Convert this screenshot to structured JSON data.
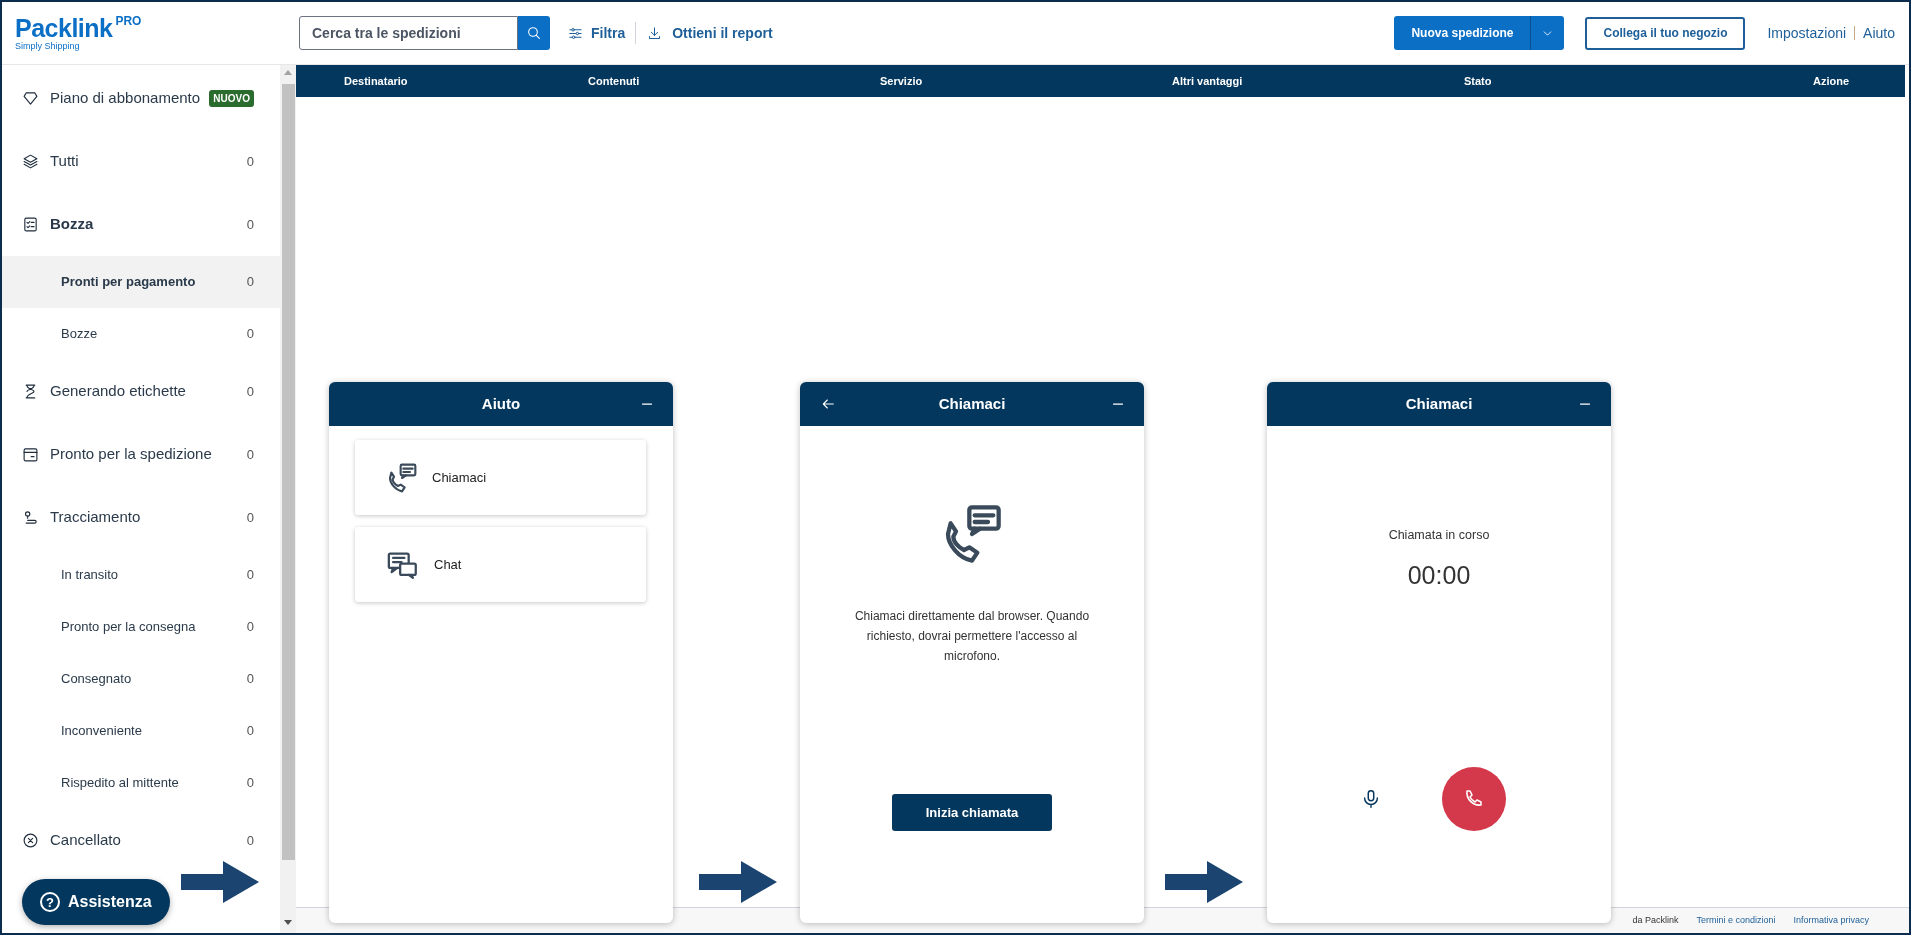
{
  "header": {
    "logo": "Packlink",
    "logo_badge": "PRO",
    "logo_tagline": "Simply Shipping",
    "search": {
      "placeholder": "Cerca tra le spedizioni"
    },
    "filter": "Filtra",
    "report": "Ottieni il report",
    "new_shipment": "Nuova spedizione",
    "connect_store": "Collega il tuo negozio",
    "links": [
      "Impostazioni",
      "Aiuto"
    ]
  },
  "sidebar": {
    "items": [
      {
        "label": "Piano di abbonamento",
        "kind": "plan",
        "badge": "NUOVO",
        "selected": false
      },
      {
        "label": "Tutti",
        "kind": "all",
        "count": "0",
        "selected": false
      },
      {
        "label": "Bozza",
        "kind": "draft",
        "count": "0",
        "selected": false,
        "children": [
          {
            "label": "Pronti per pagamento",
            "count": "0",
            "selected": true
          },
          {
            "label": "Bozze",
            "count": "0",
            "selected": false
          }
        ]
      },
      {
        "label": "Generando etichette",
        "kind": "labels",
        "count": "0",
        "selected": false
      },
      {
        "label": "Pronto per la spedizione",
        "kind": "ready",
        "count": "0",
        "selected": false
      },
      {
        "label": "Tracciamento",
        "kind": "tracking",
        "count": "0",
        "selected": false,
        "children": [
          {
            "label": "In transito",
            "count": "0",
            "selected": false
          },
          {
            "label": "Pronto per la consegna",
            "count": "0",
            "selected": false
          },
          {
            "label": "Consegnato",
            "count": "0",
            "selected": false
          },
          {
            "label": "Inconveniente",
            "count": "0",
            "selected": false
          },
          {
            "label": "Rispedito al mittente",
            "count": "0",
            "selected": false
          }
        ]
      },
      {
        "label": "Cancellato",
        "kind": "cancelled",
        "count": "0",
        "selected": false
      }
    ]
  },
  "table": {
    "columns": [
      "Destinatario",
      "Contenuti",
      "Servizio",
      "Altri vantaggi",
      "Stato",
      "Azione"
    ]
  },
  "help_panels": [
    {
      "kind": "menu",
      "title": "Aiuto",
      "back": false,
      "options": [
        {
          "label": "Chiamaci",
          "kind": "call"
        },
        {
          "label": "Chat",
          "kind": "chat"
        }
      ]
    },
    {
      "kind": "intro",
      "title": "Chiamaci",
      "back": true,
      "message": "Chiamaci direttamente dal browser. Quando richiesto, dovrai permettere l'accesso al microfono.",
      "button": "Inizia chiamata"
    },
    {
      "kind": "call",
      "title": "Chiamaci",
      "back": false,
      "status": "Chiamata in corso",
      "timer": "00:00"
    }
  ],
  "assist_button": {
    "icon": "?",
    "label": "Assistenza"
  },
  "footer": {
    "credit": "da Packlink",
    "links": [
      "Termini e condizioni",
      "Informativa privacy"
    ]
  }
}
